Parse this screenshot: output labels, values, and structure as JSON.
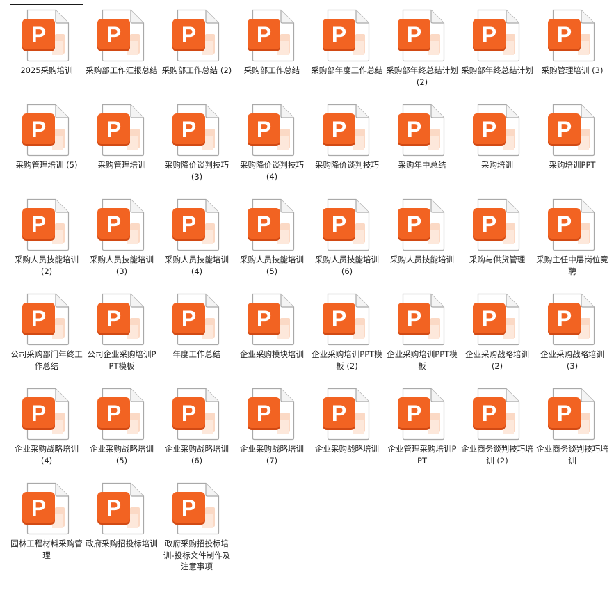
{
  "colors": {
    "accent": "#f26322",
    "accent_dark": "#d24a14",
    "accent_light": "#fbd9c5",
    "page_outline": "#a9a9a9"
  },
  "files": [
    {
      "name": "2025采购培训",
      "icon": "powerpoint-file-icon",
      "selected": true
    },
    {
      "name": "采购部工作汇报总结",
      "icon": "powerpoint-file-icon"
    },
    {
      "name": "采购部工作总结 (2)",
      "icon": "powerpoint-file-icon"
    },
    {
      "name": "采购部工作总结",
      "icon": "powerpoint-file-icon"
    },
    {
      "name": "采购部年度工作总结",
      "icon": "powerpoint-file-icon"
    },
    {
      "name": "采购部年终总结计划 (2)",
      "icon": "powerpoint-file-icon"
    },
    {
      "name": "采购部年终总结计划",
      "icon": "powerpoint-file-icon"
    },
    {
      "name": "采购管理培训 (3)",
      "icon": "powerpoint-file-icon"
    },
    {
      "name": "采购管理培训 (5)",
      "icon": "powerpoint-file-icon"
    },
    {
      "name": "采购管理培训",
      "icon": "powerpoint-file-icon"
    },
    {
      "name": "采购降价谈判技巧 (3)",
      "icon": "powerpoint-file-icon"
    },
    {
      "name": "采购降价谈判技巧 (4)",
      "icon": "powerpoint-file-icon"
    },
    {
      "name": "采购降价谈判技巧",
      "icon": "powerpoint-file-icon"
    },
    {
      "name": "采购年中总结",
      "icon": "powerpoint-file-icon"
    },
    {
      "name": "采购培训",
      "icon": "powerpoint-file-icon"
    },
    {
      "name": "采购培训PPT",
      "icon": "powerpoint-file-icon"
    },
    {
      "name": "采购人员技能培训 (2)",
      "icon": "powerpoint-file-icon"
    },
    {
      "name": "采购人员技能培训 (3)",
      "icon": "powerpoint-file-icon"
    },
    {
      "name": "采购人员技能培训 (4)",
      "icon": "powerpoint-file-icon"
    },
    {
      "name": "采购人员技能培训 (5)",
      "icon": "powerpoint-file-icon"
    },
    {
      "name": "采购人员技能培训 (6)",
      "icon": "powerpoint-file-icon"
    },
    {
      "name": "采购人员技能培训",
      "icon": "powerpoint-file-icon"
    },
    {
      "name": "采购与供货管理",
      "icon": "powerpoint-file-icon"
    },
    {
      "name": "采购主任中层岗位竞聘",
      "icon": "powerpoint-file-icon"
    },
    {
      "name": "公司采购部门年终工作总结",
      "icon": "powerpoint-file-icon"
    },
    {
      "name": "公司企业采购培训PPT模板",
      "icon": "powerpoint-file-icon"
    },
    {
      "name": "年度工作总结",
      "icon": "powerpoint-file-icon"
    },
    {
      "name": "企业采购模块培训",
      "icon": "powerpoint-file-icon"
    },
    {
      "name": "企业采购培训PPT模板 (2)",
      "icon": "powerpoint-file-icon"
    },
    {
      "name": "企业采购培训PPT模板",
      "icon": "powerpoint-file-icon"
    },
    {
      "name": "企业采购战略培训 (2)",
      "icon": "powerpoint-file-icon"
    },
    {
      "name": "企业采购战略培训 (3)",
      "icon": "powerpoint-file-icon"
    },
    {
      "name": "企业采购战略培训 (4)",
      "icon": "powerpoint-file-icon"
    },
    {
      "name": "企业采购战略培训 (5)",
      "icon": "powerpoint-file-icon"
    },
    {
      "name": "企业采购战略培训 (6)",
      "icon": "powerpoint-file-icon"
    },
    {
      "name": "企业采购战略培训 (7)",
      "icon": "powerpoint-file-icon"
    },
    {
      "name": "企业采购战略培训",
      "icon": "powerpoint-file-icon"
    },
    {
      "name": "企业管理采购培训PPT",
      "icon": "powerpoint-file-icon"
    },
    {
      "name": "企业商务谈判技巧培训 (2)",
      "icon": "powerpoint-file-icon"
    },
    {
      "name": "企业商务谈判技巧培训",
      "icon": "powerpoint-file-icon"
    },
    {
      "name": "园林工程材料采购管理",
      "icon": "powerpoint-file-icon"
    },
    {
      "name": "政府采购招投标培训",
      "icon": "powerpoint-file-icon"
    },
    {
      "name": "政府采购招投标培训-投标文件制作及注意事项",
      "icon": "powerpoint-file-icon"
    }
  ]
}
